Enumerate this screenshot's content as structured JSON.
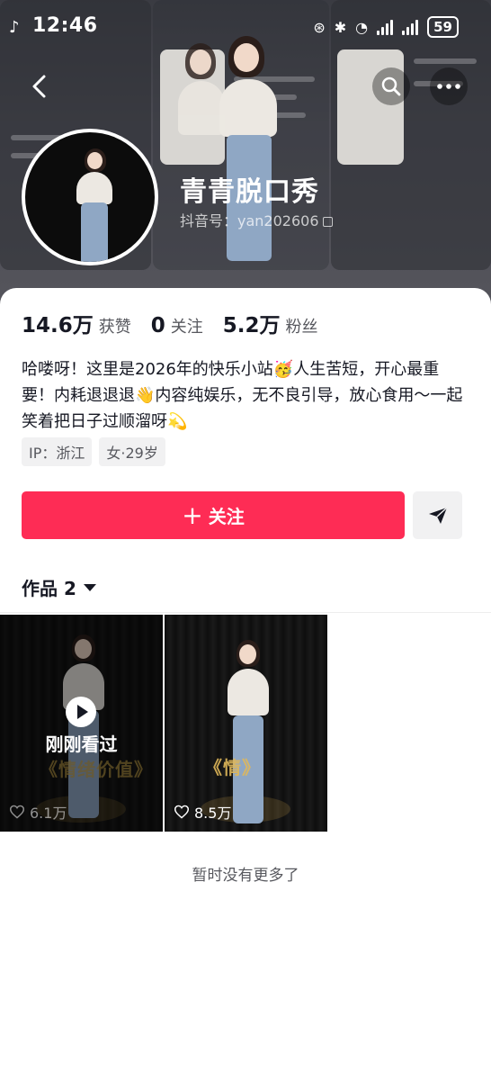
{
  "status_bar": {
    "time": "12:46",
    "battery": "59"
  },
  "profile": {
    "name": "青青脱口秀",
    "douyin_id": "抖音号：yan202606"
  },
  "stats": [
    {
      "value": "14.6万",
      "label": "获赞"
    },
    {
      "value": "0",
      "label": "关注"
    },
    {
      "value": "5.2万",
      "label": "粉丝"
    }
  ],
  "bio": "哈喽呀！这里是2026年的快乐小站🥳人生苦短，开心最重要！内耗退退退👋内容纯娱乐，无不良引导，放心食用～一起笑着把日子过顺溜呀💫",
  "tags": [
    "IP：浙江",
    "女·29岁"
  ],
  "actions": {
    "follow_label": "关注",
    "follow_plus": "+"
  },
  "works": {
    "tab_label": "作品 2",
    "videos": [
      {
        "overlay_text": "刚刚看过",
        "caption": "《情绪价值》",
        "likes": "6.1万",
        "watched": true
      },
      {
        "caption": "《情》",
        "likes": "8.5万",
        "watched": false
      }
    ]
  },
  "footer": {
    "no_more_text": "暂时没有更多了"
  },
  "colors": {
    "accent": "#fe2c55",
    "text_primary": "#161823",
    "text_secondary": "#57585e",
    "tag_bg": "#f1f1f2"
  },
  "icons": [
    "tiktok-logo-icon",
    "back-arrow-icon",
    "search-icon",
    "more-icon",
    "copy-icon",
    "share-icon",
    "caret-down-icon",
    "play-icon",
    "heart-icon"
  ]
}
